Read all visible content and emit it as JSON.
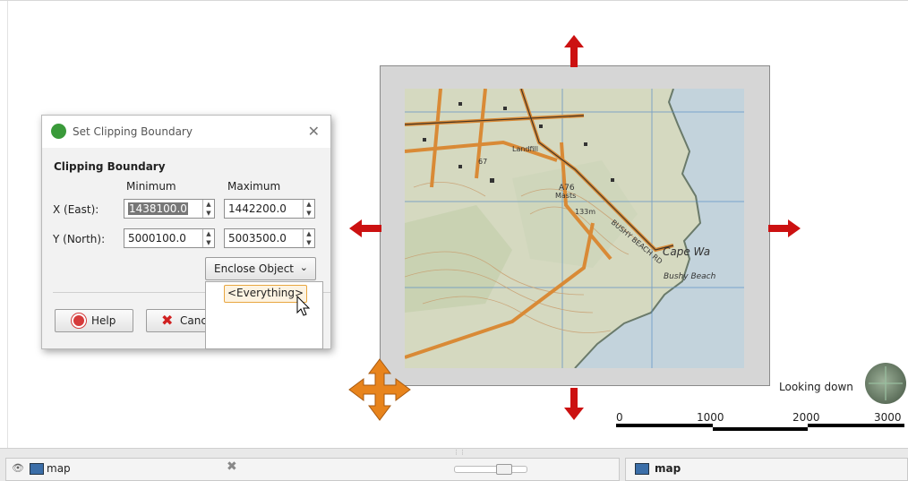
{
  "dialog": {
    "title": "Set Clipping Boundary",
    "close_glyph": "✕",
    "group_title": "Clipping Boundary",
    "col_min": "Minimum",
    "col_max": "Maximum",
    "x_label": "X (East):",
    "y_label": "Y (North):",
    "x_min": "1438100.0",
    "x_max": "1442200.0",
    "y_min": "5000100.0",
    "y_max": "5003500.0",
    "enclose_label": "Enclose Object",
    "help_label": "Help",
    "cancel_label": "Canc",
    "dropdown_item": "<Everything>"
  },
  "map": {
    "place_cape": "Cape Wa",
    "place_beach": "Bushy Beach",
    "road_label": "BUSHY BEACH RD",
    "landfill": "Landfill",
    "masts": "Masts",
    "summit": "A76",
    "height": "133m",
    "spot": "67"
  },
  "scale": {
    "t0": "0",
    "t1": "1000",
    "t2": "2000",
    "t3": "3000"
  },
  "view_label": "Looking down",
  "bottom": {
    "left_title": "map",
    "right_title": "map"
  },
  "colors": {
    "arrow_red": "#cc1111",
    "move_handle": "#e8841c",
    "sea": "#c3d3dc",
    "road": "#d98a36"
  },
  "icons": {
    "dialog": "clipping-icon",
    "help": "lifebuoy-icon",
    "cancel": "red-x-icon",
    "eye": "eye-icon",
    "compass": "compass-icon"
  }
}
